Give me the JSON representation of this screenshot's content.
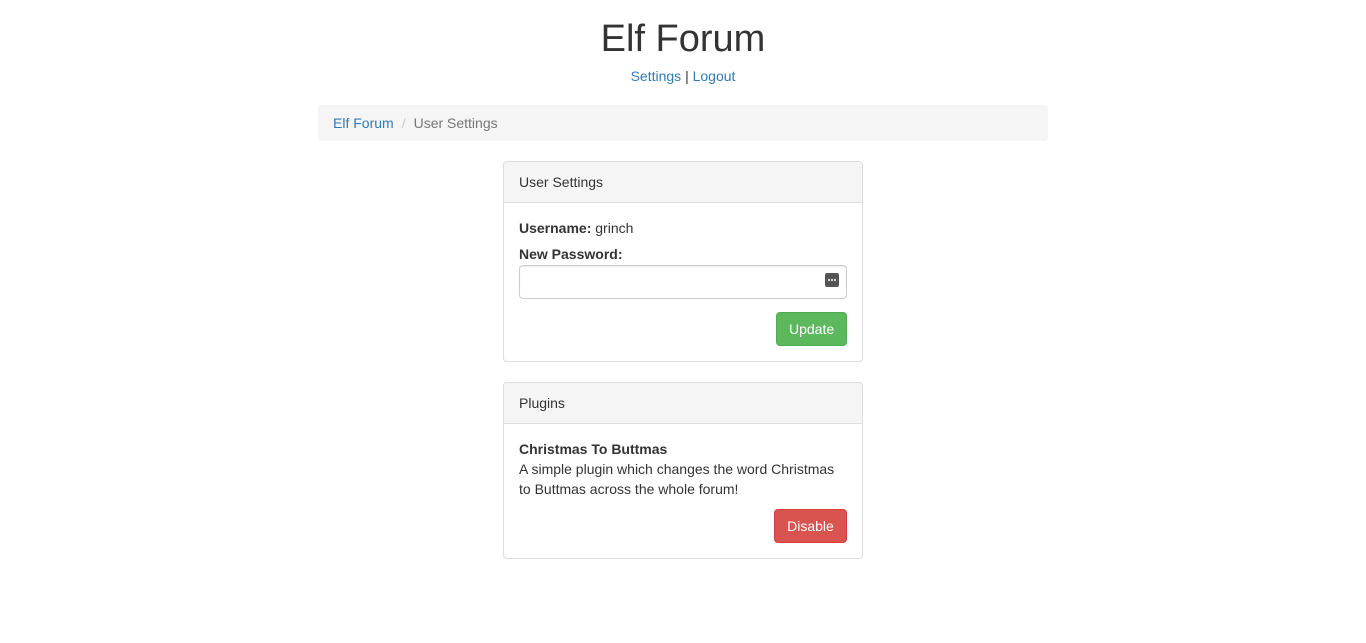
{
  "header": {
    "title": "Elf Forum",
    "links": {
      "settings": "Settings",
      "separator": "|",
      "logout": "Logout"
    }
  },
  "breadcrumb": {
    "home": "Elf Forum",
    "divider": "/",
    "current": "User Settings"
  },
  "user_settings": {
    "heading": "User Settings",
    "username_label": "Username:",
    "username_value": "grinch",
    "password_label": "New Password:",
    "password_value": "",
    "update_label": "Update"
  },
  "plugins": {
    "heading": "Plugins",
    "items": [
      {
        "name": "Christmas To Buttmas",
        "description": "A simple plugin which changes the word Christmas to Buttmas across the whole forum!",
        "action_label": "Disable"
      }
    ]
  },
  "colors": {
    "link": "#337ab7",
    "success": "#5cb85c",
    "danger": "#d9534f",
    "panel_heading_bg": "#f5f5f5"
  }
}
